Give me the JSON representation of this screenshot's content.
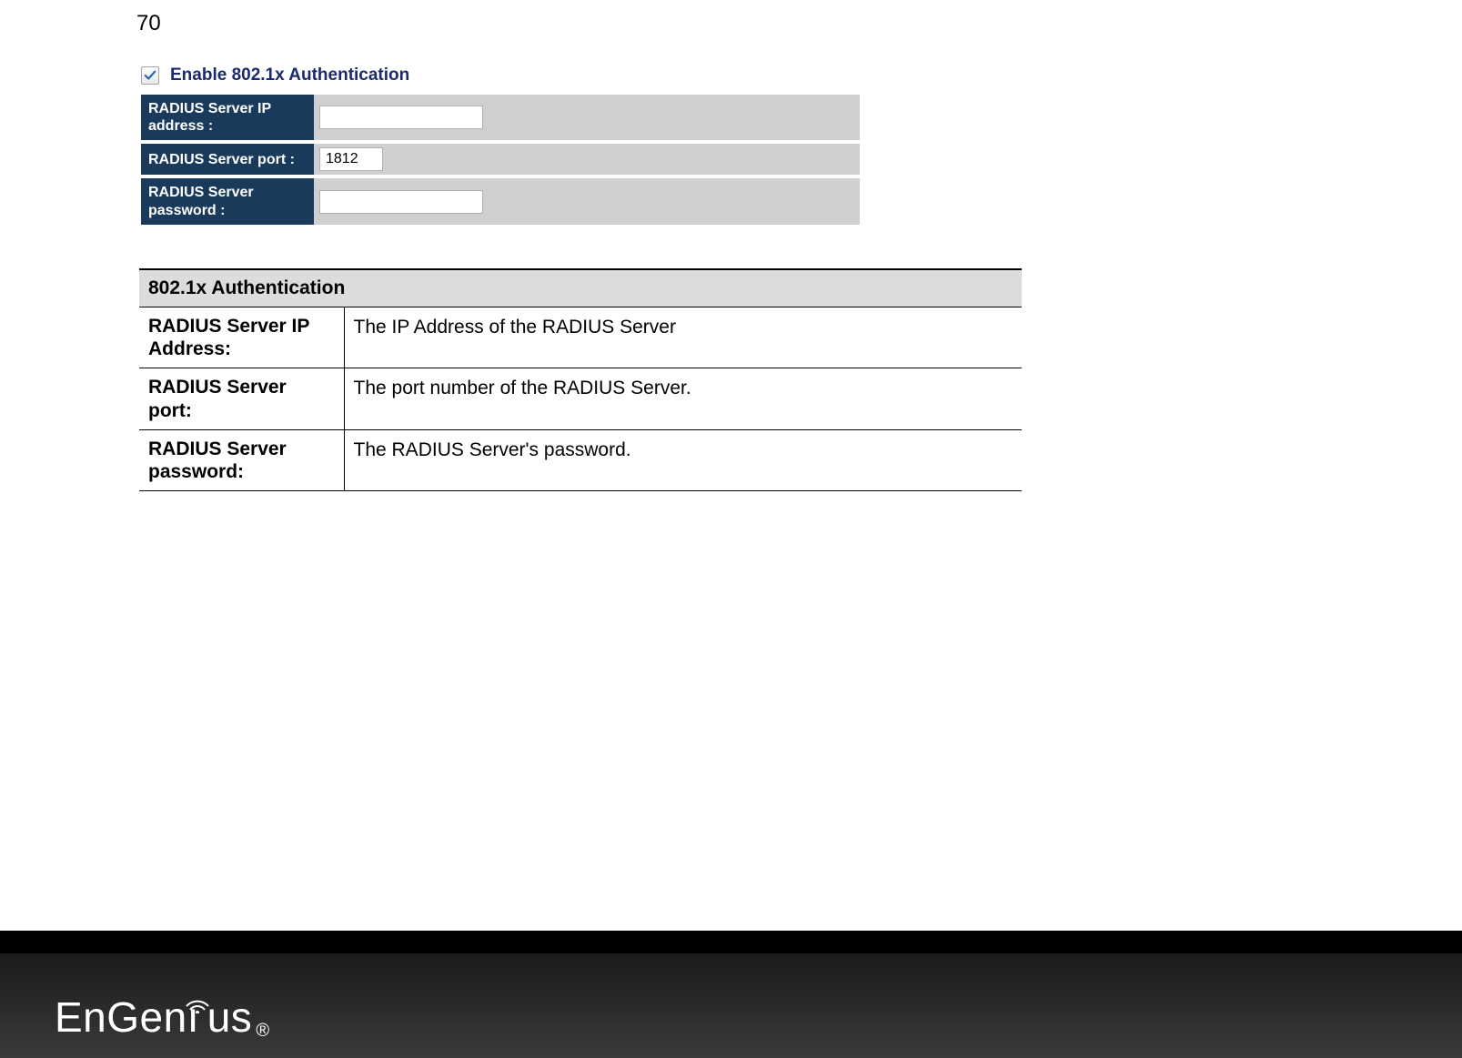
{
  "page_number": "70",
  "config": {
    "enable_checked": true,
    "enable_label": "Enable 802.1x Authentication",
    "rows": [
      {
        "label": "RADIUS Server IP address :",
        "value": "",
        "cls": "ip-input"
      },
      {
        "label": "RADIUS Server port :",
        "value": "1812",
        "cls": "port-input"
      },
      {
        "label": "RADIUS Server password :",
        "value": "",
        "cls": "pw-input"
      }
    ]
  },
  "desc": {
    "header": "802.1x Authentication",
    "rows": [
      {
        "label": "RADIUS Server IP Address:",
        "value": "The IP Address of the RADIUS Server"
      },
      {
        "label": "RADIUS Server port:",
        "value": "The port number of the RADIUS Server."
      },
      {
        "label": "RADIUS Server password:",
        "value": "The RADIUS Server's password."
      }
    ]
  },
  "brand": {
    "part1": "En",
    "part2": "Gen",
    "part3": "us",
    "reg": "®"
  }
}
